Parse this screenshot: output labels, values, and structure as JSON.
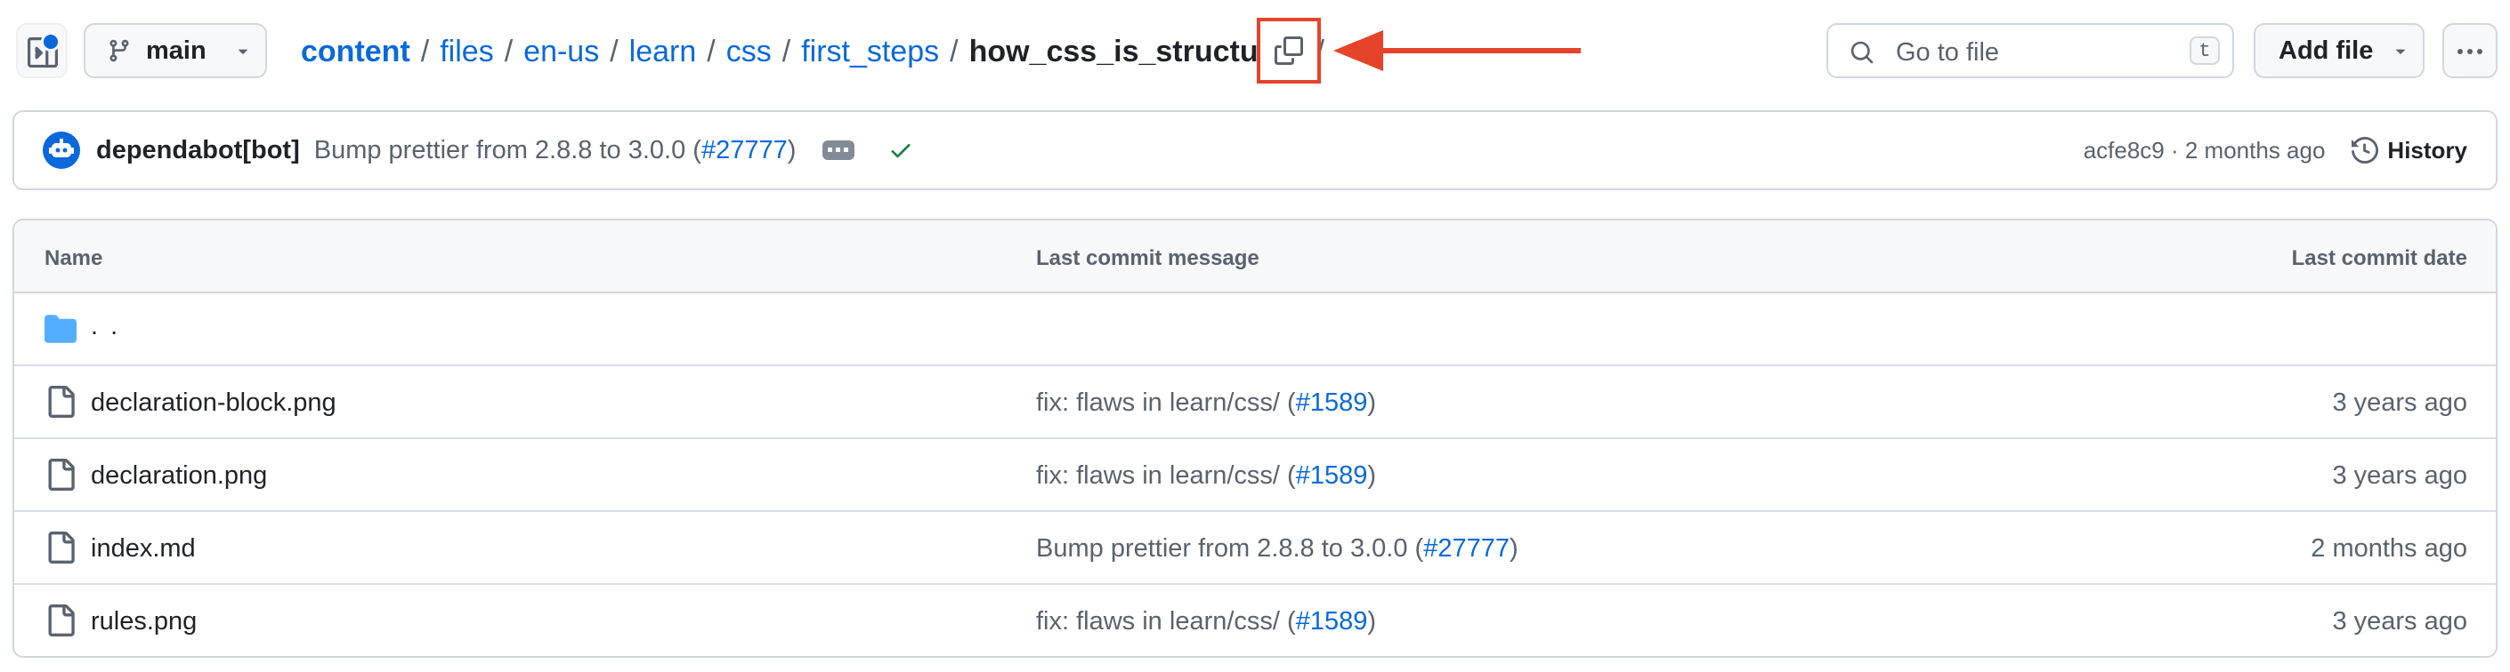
{
  "header": {
    "branch": "main",
    "breadcrumb": {
      "root": "content",
      "links": [
        "files",
        "en-us",
        "learn",
        "css",
        "first_steps"
      ],
      "current": "how_css_is_structured",
      "separator": "/"
    },
    "search": {
      "placeholder": "Go to file",
      "shortcut": "t"
    },
    "add_file_label": "Add file"
  },
  "commit": {
    "author": "dependabot[bot]",
    "message_prefix": "Bump prettier from 2.8.8 to 3.0.0 (",
    "pr_link": "#27777",
    "message_suffix": ")",
    "hash_and_time": "acfe8c9 · 2 months ago",
    "history_label": "History"
  },
  "table": {
    "columns": {
      "name": "Name",
      "message": "Last commit message",
      "date": "Last commit date"
    },
    "parent_label": ". .",
    "rows": [
      {
        "name": "declaration-block.png",
        "msg_prefix": "fix: flaws in learn/css/ (",
        "msg_link": "#1589",
        "msg_suffix": ")",
        "date": "3 years ago"
      },
      {
        "name": "declaration.png",
        "msg_prefix": "fix: flaws in learn/css/ (",
        "msg_link": "#1589",
        "msg_suffix": ")",
        "date": "3 years ago"
      },
      {
        "name": "index.md",
        "msg_prefix": "Bump prettier from 2.8.8 to 3.0.0 (",
        "msg_link": "#27777",
        "msg_suffix": ")",
        "date": "2 months ago"
      },
      {
        "name": "rules.png",
        "msg_prefix": "fix: flaws in learn/css/ (",
        "msg_link": "#1589",
        "msg_suffix": ")",
        "date": "3 years ago"
      }
    ]
  },
  "colors": {
    "link": "#0969da",
    "muted": "#59636e",
    "border": "#d0d7de",
    "highlight": "#e5432a",
    "success": "#1a7f37"
  },
  "icons": [
    "sidebar-expand-icon",
    "git-branch-icon",
    "triangle-down-icon",
    "copy-icon",
    "arrow-left-icon",
    "search-icon",
    "kebab-horizontal-icon",
    "copilot-bot-icon",
    "ellipsis-icon",
    "check-icon",
    "history-icon",
    "folder-icon",
    "file-icon"
  ]
}
